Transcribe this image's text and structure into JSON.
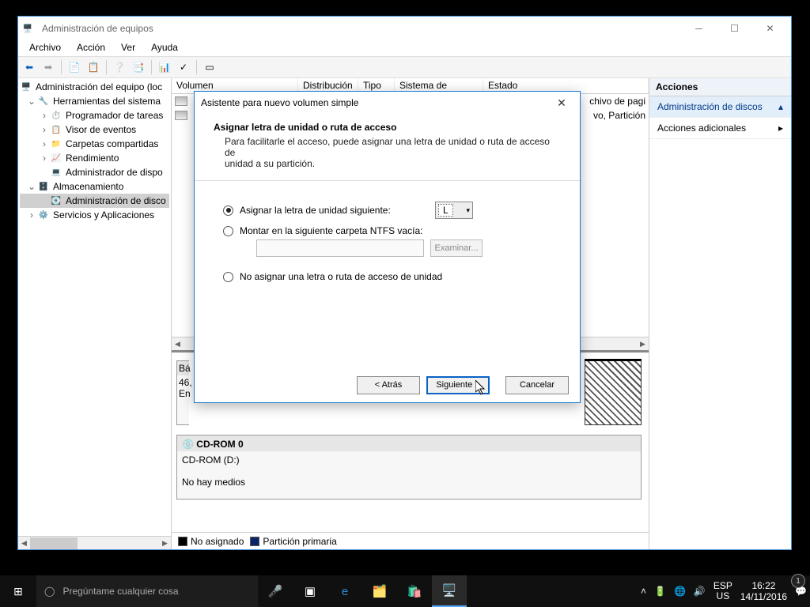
{
  "window": {
    "title": "Administración de equipos",
    "menu": {
      "file": "Archivo",
      "action": "Acción",
      "view": "Ver",
      "help": "Ayuda"
    }
  },
  "tree": {
    "root": "Administración del equipo (loc",
    "systools": "Herramientas del sistema",
    "scheduler": "Programador de tareas",
    "eventviewer": "Visor de eventos",
    "sharedfolders": "Carpetas compartidas",
    "performance": "Rendimiento",
    "devmgr": "Administrador de dispo",
    "storage": "Almacenamiento",
    "diskmgmt": "Administración de disco",
    "services": "Servicios y Aplicaciones"
  },
  "list": {
    "cols": {
      "volume": "Volumen",
      "layout": "Distribución",
      "type": "Tipo",
      "fs": "Sistema de archivos",
      "status": "Estado"
    },
    "frag1": "chivo de pagi",
    "frag2": "vo, Partición"
  },
  "actions": {
    "header": "Acciones",
    "main": "Administración de discos",
    "more": "Acciones adicionales"
  },
  "diskmap": {
    "disk0_prefix": "Bá",
    "disk0_size": "46,",
    "disk0_state": "En",
    "cdrom_title": "CD-ROM 0",
    "cdrom_label": "CD-ROM (D:)",
    "cdrom_state": "No hay medios",
    "legend_unalloc": "No asignado",
    "legend_primary": "Partición primaria"
  },
  "wizard": {
    "title": "Asistente para nuevo volumen simple",
    "h1": "Asignar letra de unidad o ruta de acceso",
    "h2a": "Para facilitarle el acceso, puede asignar una letra de unidad o ruta de acceso de",
    "h2b": "unidad a su partición.",
    "opt1": "Asignar la letra de unidad siguiente:",
    "drive": "L",
    "opt2": "Montar en la siguiente carpeta NTFS vacía:",
    "browse": "Examinar...",
    "opt3": "No asignar una letra o ruta de acceso de unidad",
    "back": "< Atrás",
    "next": "Siguiente >",
    "cancel": "Cancelar"
  },
  "taskbar": {
    "search_placeholder": "Pregúntame cualquier cosa",
    "lang1": "ESP",
    "lang2": "US",
    "time": "16:22",
    "date": "14/11/2016"
  }
}
